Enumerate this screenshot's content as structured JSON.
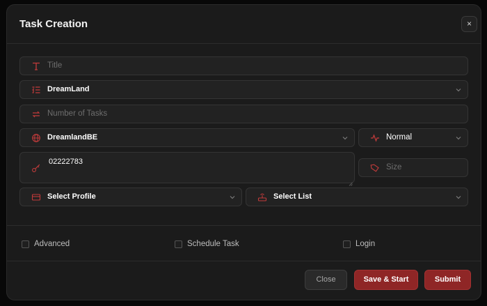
{
  "modal": {
    "title": "Task Creation",
    "close_glyph": "×"
  },
  "fields": {
    "title_placeholder": "Title",
    "store_value": "DreamLand",
    "number_placeholder": "Number of Tasks",
    "region_value": "DreamlandBE",
    "mode_value": "Normal",
    "input_value": "02222783",
    "size_placeholder": "Size",
    "profile_value": "Select Profile",
    "list_value": "Select List"
  },
  "icons": {
    "title": "text-icon",
    "store": "list-icon",
    "number": "repeat-icon",
    "region": "globe-icon",
    "mode": "pulse-icon",
    "input": "key-icon",
    "size": "tag-icon",
    "profile": "card-icon",
    "list": "router-icon",
    "chevron": "chevron-down-icon"
  },
  "options": {
    "advanced": "Advanced",
    "schedule": "Schedule Task",
    "login": "Login"
  },
  "buttons": {
    "close": "Close",
    "save_start": "Save & Start",
    "submit": "Submit"
  },
  "colors": {
    "accent": "#a33232",
    "icon": "#c23b3b",
    "background": "#1b1b1b"
  }
}
